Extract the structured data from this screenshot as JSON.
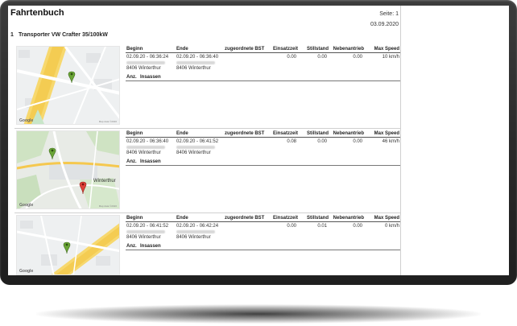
{
  "report": {
    "title": "Fahrtenbuch",
    "page_label": "Seite: 1",
    "date": "03.09.2020",
    "vehicle_number": "1",
    "vehicle_name": "Transporter VW Crafter 35/100kW"
  },
  "table_headers": {
    "begin": "Beginn",
    "end": "Ende",
    "cost_center": "zugeordnete BST",
    "usage_time": "Einsatzzeit",
    "idle": "Stillstand",
    "aux_drive": "Nebenantrieb",
    "max_speed": "Max Speed",
    "count": "Anz.",
    "passengers": "Insassen"
  },
  "trips": [
    {
      "begin_time": "02.09.20 - 06:36:24",
      "end_time": "02.09.20 - 06:36:40",
      "begin_city": "8406 Winterthur",
      "end_city": "8406 Winterthur",
      "usage_time": "0.00",
      "idle": "0.00",
      "aux_drive": "0.00",
      "max_speed": "10 km/h",
      "map_logo": "Google",
      "map_data": "Map data ©2020"
    },
    {
      "begin_time": "02.09.20 - 06:36:40",
      "end_time": "02.09.20 - 06:41:52",
      "begin_city": "8406 Winterthur",
      "end_city": "8406 Winterthur",
      "usage_time": "0.08",
      "idle": "0.00",
      "aux_drive": "0.00",
      "max_speed": "46 km/h",
      "map_logo": "Google",
      "map_data": "Map data ©2020",
      "map_city_label": "Winterthur"
    },
    {
      "begin_time": "02.09.20 - 06:41:52",
      "end_time": "02.09.20 - 06:42:24",
      "begin_city": "8406 Winterthur",
      "end_city": "8406 Winterthur",
      "usage_time": "0.00",
      "idle": "0.01",
      "aux_drive": "0.00",
      "max_speed": "0 km/h",
      "map_logo": "Google"
    }
  ]
}
